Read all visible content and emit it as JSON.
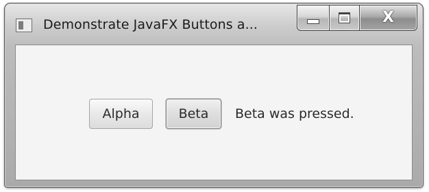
{
  "window": {
    "title": "Demonstrate JavaFX Buttons a...",
    "close_glyph": "X"
  },
  "buttons": {
    "alpha_label": "Alpha",
    "beta_label": "Beta"
  },
  "status": {
    "text": "Beta was pressed."
  },
  "icons": {
    "app": "app-icon",
    "minimize": "minimize-icon",
    "maximize": "maximize-icon",
    "close": "close-icon"
  },
  "colors": {
    "client_background": "#f4f4f4",
    "frame": "#bcbcbc",
    "text": "#2a2a2a"
  }
}
